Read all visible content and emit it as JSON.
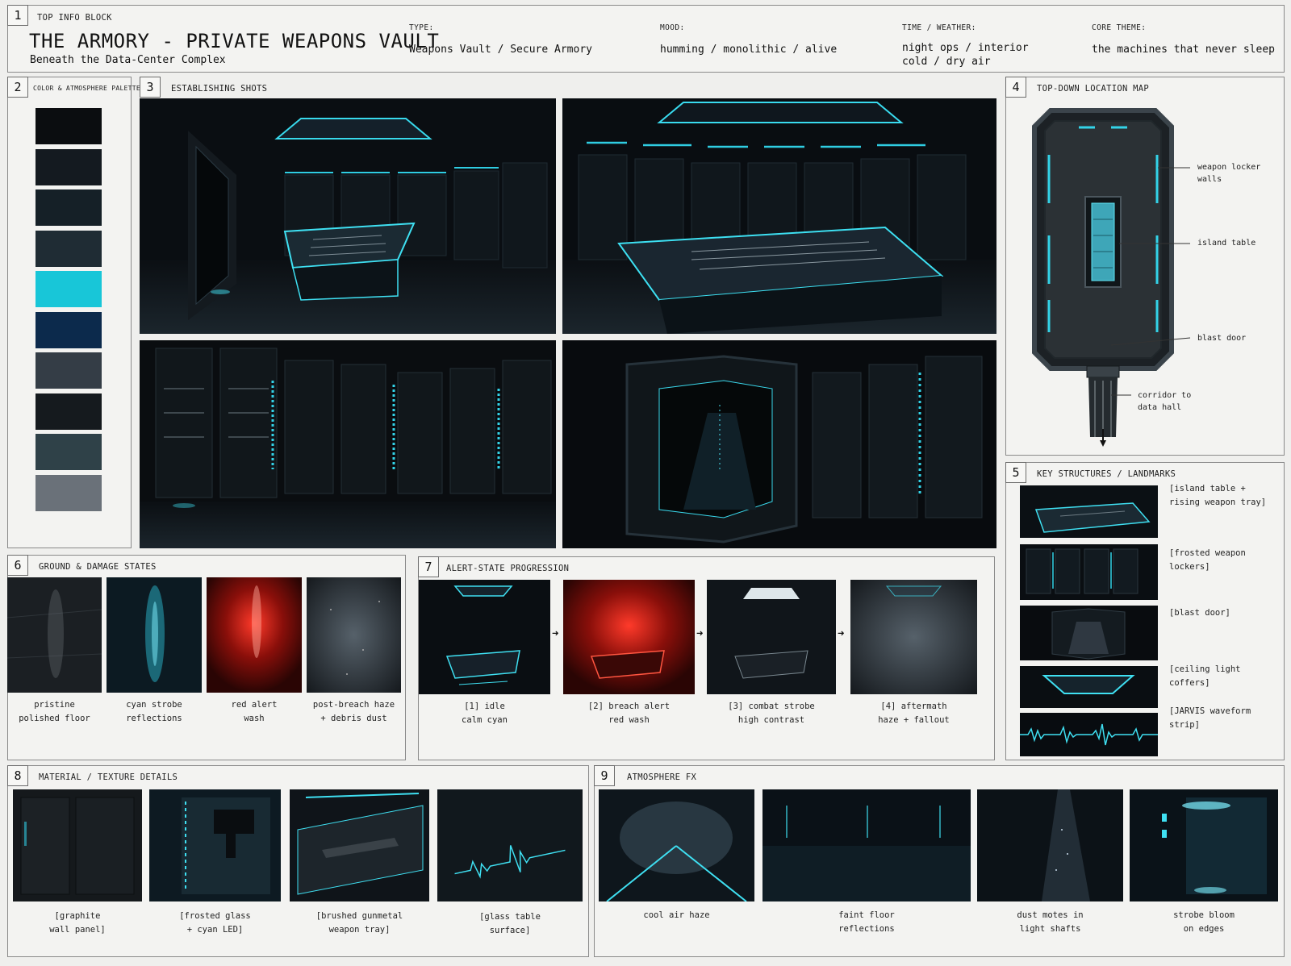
{
  "header": {
    "num": "1",
    "block_label": "TOP INFO BLOCK",
    "title": "THE ARMORY - PRIVATE WEAPONS VAULT",
    "subtitle": "Beneath the Data-Center Complex",
    "type_label": "TYPE:",
    "type_value": "Weapons Vault / Secure Armory",
    "mood_label": "MOOD:",
    "mood_value": "humming / monolithic / alive",
    "time_label": "TIME / WEATHER:",
    "time_value": "night ops / interior\ncold / dry air",
    "theme_label": "CORE THEME:",
    "theme_value": "the machines that never sleep"
  },
  "palette": {
    "num": "2",
    "title": "COLOR & ATMOSPHERE PALETTE",
    "colors": [
      "#0b0d10",
      "#141a20",
      "#152027",
      "#1f2c34",
      "#18c6d8",
      "#0c2a4c",
      "#343d46",
      "#151a1e",
      "#2f4148",
      "#6a7179"
    ]
  },
  "establishing": {
    "num": "3",
    "title": "ESTABLISHING SHOTS"
  },
  "map": {
    "num": "4",
    "title": "TOP-DOWN LOCATION MAP",
    "labels": {
      "walls": "weapon locker walls",
      "table": "island table",
      "door": "blast door",
      "corridor": "corridor to\ndata hall"
    }
  },
  "landmarks": {
    "num": "5",
    "title": "KEY STRUCTURES / LANDMARKS",
    "items": [
      {
        "label": "[island table +\n rising weapon tray]"
      },
      {
        "label": "[frosted weapon\n lockers]"
      },
      {
        "label": "[blast door]"
      },
      {
        "label": "[ceiling light coffers]"
      },
      {
        "label": "[JARVIS waveform strip]"
      }
    ]
  },
  "ground": {
    "num": "6",
    "title": "GROUND & DAMAGE STATES",
    "items": [
      {
        "label": "pristine\npolished floor"
      },
      {
        "label": "cyan strobe\nreflections"
      },
      {
        "label": "red alert\nwash"
      },
      {
        "label": "post-breach haze\n+ debris dust"
      }
    ]
  },
  "alert": {
    "num": "7",
    "title": "ALERT-STATE PROGRESSION",
    "items": [
      {
        "label": "[1] idle\ncalm cyan"
      },
      {
        "label": "[2] breach alert\nred wash"
      },
      {
        "label": "[3] combat strobe\nhigh contrast"
      },
      {
        "label": "[4] aftermath\nhaze + fallout"
      }
    ]
  },
  "material": {
    "num": "8",
    "title": "MATERIAL / TEXTURE DETAILS",
    "items": [
      {
        "label": "[graphite\nwall panel]"
      },
      {
        "label": "[frosted glass\n+ cyan LED]"
      },
      {
        "label": "[brushed gunmetal\nweapon tray]"
      },
      {
        "label": "[glass table\nsurface]"
      }
    ]
  },
  "atmos": {
    "num": "9",
    "title": "ATMOSPHERE FX",
    "items": [
      {
        "label": "cool air haze"
      },
      {
        "label": "faint floor\nreflections"
      },
      {
        "label": "dust motes in\nlight shafts"
      },
      {
        "label": "strobe bloom\non edges"
      }
    ]
  },
  "accent": {
    "cyan": "#27d3ea",
    "red": "#e0241d"
  }
}
